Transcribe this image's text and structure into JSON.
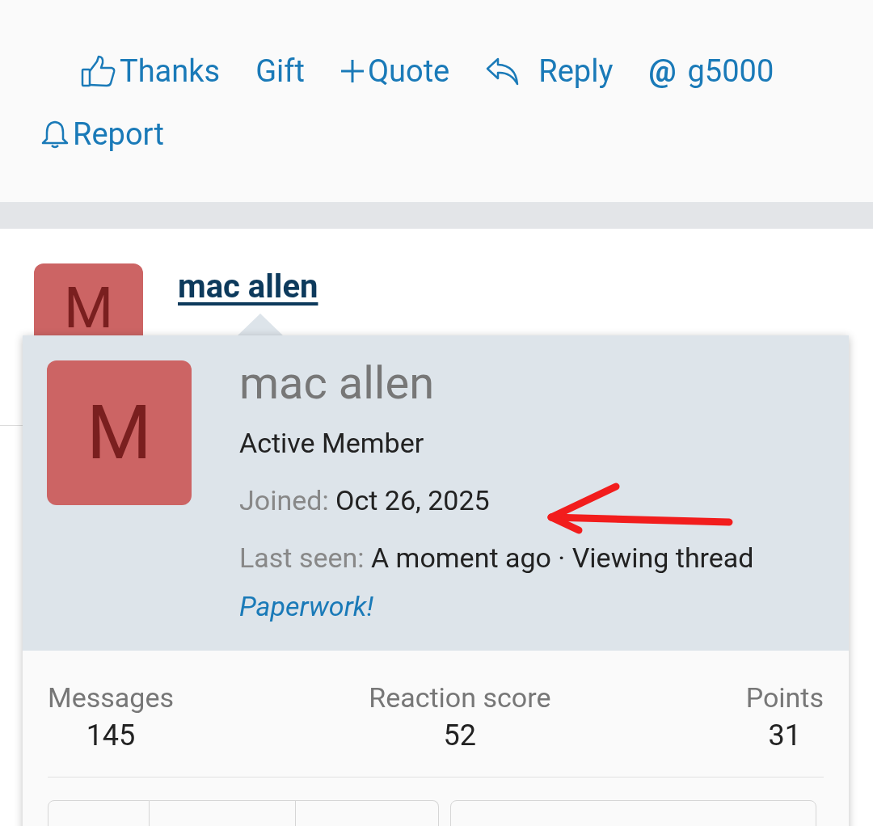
{
  "post_actions": [
    {
      "kind": "thumb",
      "label": "Thanks"
    },
    {
      "kind": "none",
      "label": "Gift"
    },
    {
      "kind": "plus",
      "label": "Quote"
    },
    {
      "kind": "reply",
      "label": "Reply"
    },
    {
      "kind": "at",
      "icon": "@",
      "label": "g5000"
    },
    {
      "kind": "bell",
      "label": "Report"
    }
  ],
  "post": {
    "avatar_letter": "M",
    "username": "mac allen"
  },
  "member_card": {
    "avatar_letter": "M",
    "name": "mac allen",
    "title": "Active Member",
    "joined_label": "Joined:",
    "joined": "Oct 26, 2025",
    "last_seen_label": "Last seen:",
    "last_seen": "A moment ago · Viewing thread",
    "thread_link": "Paperwork!",
    "stats": [
      {
        "label": "Messages",
        "value": "145"
      },
      {
        "label": "Reaction score",
        "value": "52"
      },
      {
        "label": "Points",
        "value": "31"
      }
    ]
  }
}
